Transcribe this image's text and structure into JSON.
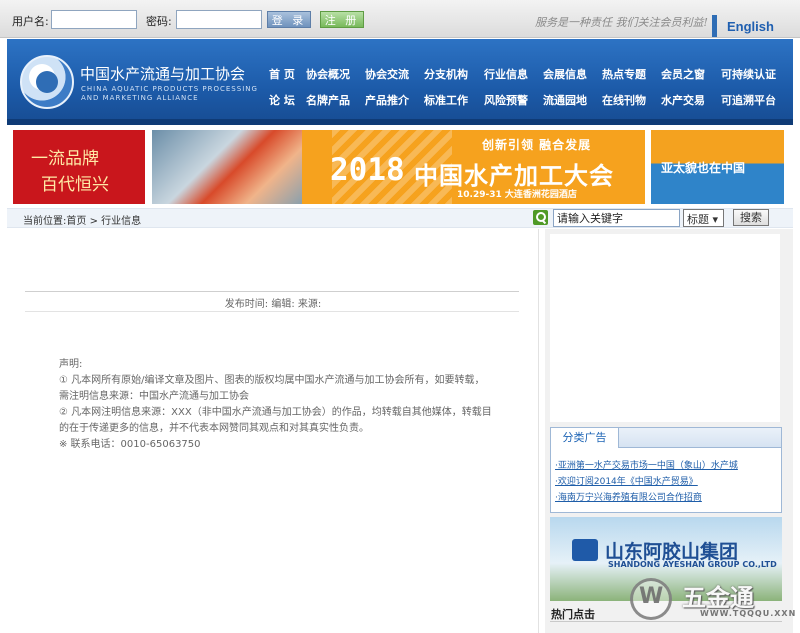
{
  "topbar": {
    "username_label": "用户名:",
    "password_label": "密码:",
    "login_button": "登 录",
    "register_button": "注 册",
    "slogan": "服务是一种责任 我们关注会员利益!",
    "english_link": "English"
  },
  "header": {
    "org_name_cn": "中国水产流通与加工协会",
    "org_name_en_line1": "CHINA AQUATIC PRODUCTS PROCESSING",
    "org_name_en_line2": "AND MARKETING ALLIANCE",
    "nav_row1": [
      "首 页",
      "协会概况",
      "协会交流",
      "分支机构",
      "行业信息",
      "会展信息",
      "热点专题",
      "会员之窗",
      "可持续认证"
    ],
    "nav_row2": [
      "论 坛",
      "名牌产品",
      "产品推介",
      "标准工作",
      "风险预警",
      "流通园地",
      "在线刊物",
      "水产交易",
      "可追溯平台"
    ]
  },
  "banners": {
    "left_line1": "一流品牌",
    "left_line2": "百代恒兴",
    "main_subtitle": "创新引领 融合发展",
    "main_year": "2018",
    "main_title": "中国水产加工大会",
    "main_date": "10.29-31 大连香洲花园酒店",
    "right_text": "亚太貌也在中国"
  },
  "location": {
    "label": "当前位置:",
    "home": "首页",
    "sep": ">",
    "current": "行业信息"
  },
  "search": {
    "placeholder": "请输入关键字",
    "field_select": "标题",
    "button": "搜索"
  },
  "article": {
    "pub_info": "发布时间: 编辑: 来源:",
    "declaration": [
      "声明:",
      "① 凡本网所有原始/编译文章及图片、图表的版权均属中国水产流通与加工协会所有，如要转载，",
      "需注明信息来源：中国水产流通与加工协会",
      "② 凡本网注明信息来源：XXX（非中国水产流通与加工协会）的作品，均转载自其他媒体，转载目",
      "的在于传递更多的信息，并不代表本网赞同其观点和对其真实性负责。",
      "※ 联系电话：0010-65063750"
    ]
  },
  "sidebar": {
    "ad_tab": "分类广告",
    "ad_items": [
      "·亚洲第一水产交易市场一中国（象山）水产城",
      "·欢迎订阅2014年《中国水产贸易》",
      "·海南万宁兴海养殖有限公司合作招商"
    ],
    "group_cn": "山东阿胶山集团",
    "group_en": "SHANDONG AYESHAN GROUP CO.,LTD",
    "hot_title": "热门点击"
  },
  "watermark": {
    "cn": "五金通",
    "en": "WWW.TQQQU.XXN"
  }
}
